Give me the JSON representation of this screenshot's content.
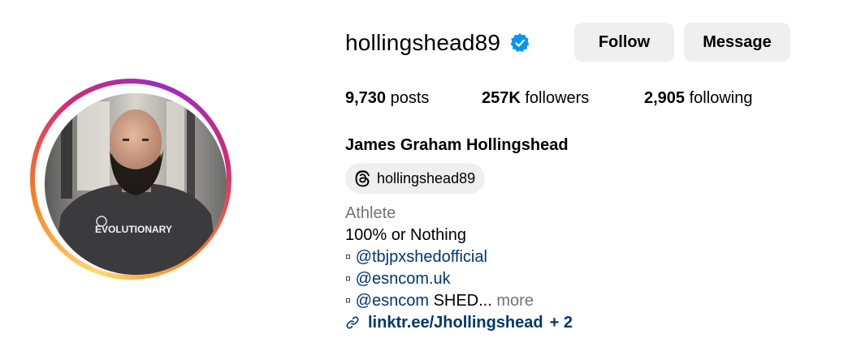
{
  "profile": {
    "username": "hollingshead89",
    "verified": true,
    "full_name": "James Graham Hollingshead",
    "avatar_shirt_text": "EVOLUTIONARY"
  },
  "actions": {
    "follow_label": "Follow",
    "message_label": "Message"
  },
  "stats": {
    "posts_count": "9,730",
    "posts_label": "posts",
    "followers_count": "257K",
    "followers_label": "followers",
    "following_count": "2,905",
    "following_label": "following"
  },
  "threads": {
    "handle": "hollingshead89",
    "icon": "threads-icon"
  },
  "bio": {
    "category": "Athlete",
    "line1": "100% or Nothing",
    "bullet": "▫",
    "mention1": "@tbjpxshedofficial",
    "mention2": "@esncom.uk",
    "mention3": "@esncom",
    "line5_rest": "SHED...",
    "more_label": "more"
  },
  "link": {
    "icon": "link-icon",
    "url": "linktr.ee/Jhollingshead",
    "extra": "+ 2"
  },
  "colors": {
    "verified_blue": "#0095f6",
    "button_bg": "#efefef",
    "link_color": "#00376b",
    "secondary_text": "#737373"
  }
}
